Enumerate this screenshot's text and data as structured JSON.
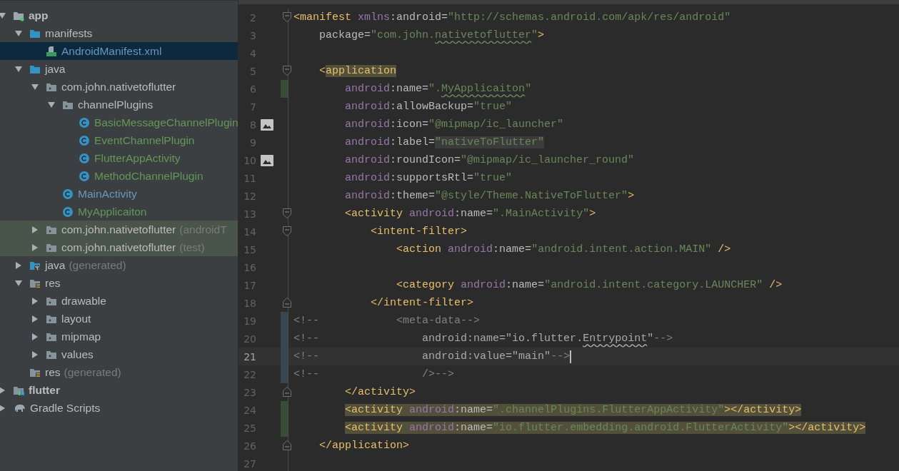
{
  "project_tree": [
    {
      "label": "app",
      "kind": "module",
      "bold": true,
      "expanded": true,
      "selected": false,
      "highlighted": false,
      "color": "#bbbbbb",
      "children": [
        {
          "label": "manifests",
          "kind": "folder",
          "expanded": true,
          "selected": false,
          "highlighted": false,
          "color": "#bbbbbb",
          "children": [
            {
              "label": "AndroidManifest.xml",
              "kind": "manifest",
              "selected": true,
              "highlighted": false,
              "color": "#6897bb"
            }
          ]
        },
        {
          "label": "java",
          "kind": "folder",
          "expanded": true,
          "selected": false,
          "highlighted": false,
          "color": "#bbbbbb",
          "children": [
            {
              "label": "com.john.nativetoflutter",
              "kind": "package",
              "expanded": true,
              "selected": false,
              "highlighted": false,
              "color": "#bbbbbb",
              "children": [
                {
                  "label": "channelPlugins",
                  "kind": "package",
                  "expanded": true,
                  "selected": false,
                  "highlighted": false,
                  "color": "#bbbbbb",
                  "children": [
                    {
                      "label": "BasicMessageChannelPlugin",
                      "kind": "class",
                      "selected": false,
                      "highlighted": false,
                      "color": "#629755"
                    },
                    {
                      "label": "EventChannelPlugin",
                      "kind": "class",
                      "selected": false,
                      "highlighted": false,
                      "color": "#629755"
                    },
                    {
                      "label": "FlutterAppActivity",
                      "kind": "class",
                      "selected": false,
                      "highlighted": false,
                      "color": "#629755"
                    },
                    {
                      "label": "MethodChannelPlugin",
                      "kind": "class",
                      "selected": false,
                      "highlighted": false,
                      "color": "#629755"
                    }
                  ]
                },
                {
                  "label": "MainActivity",
                  "kind": "class",
                  "selected": false,
                  "highlighted": false,
                  "color": "#6897bb"
                },
                {
                  "label": "MyApplicaiton",
                  "kind": "class",
                  "selected": false,
                  "highlighted": false,
                  "color": "#629755"
                }
              ]
            },
            {
              "label": "com.john.nativetoflutter",
              "suffix": "(androidT",
              "kind": "package",
              "expanded": false,
              "selected": false,
              "highlighted": true,
              "color": "#bbbbbb"
            },
            {
              "label": "com.john.nativetoflutter",
              "suffix": "(test)",
              "kind": "package",
              "expanded": false,
              "selected": false,
              "highlighted": true,
              "color": "#bbbbbb"
            }
          ]
        },
        {
          "label": "java",
          "suffix": "(generated)",
          "kind": "generated",
          "expanded": false,
          "selected": false,
          "highlighted": false,
          "color": "#bbbbbb"
        },
        {
          "label": "res",
          "kind": "res",
          "expanded": true,
          "selected": false,
          "highlighted": false,
          "color": "#bbbbbb",
          "children": [
            {
              "label": "drawable",
              "kind": "package",
              "expanded": false,
              "selected": false,
              "highlighted": false,
              "color": "#bbbbbb"
            },
            {
              "label": "layout",
              "kind": "package",
              "expanded": false,
              "selected": false,
              "highlighted": false,
              "color": "#bbbbbb"
            },
            {
              "label": "mipmap",
              "kind": "package",
              "expanded": false,
              "selected": false,
              "highlighted": false,
              "color": "#bbbbbb"
            },
            {
              "label": "values",
              "kind": "package",
              "expanded": false,
              "selected": false,
              "highlighted": false,
              "color": "#bbbbbb"
            }
          ]
        },
        {
          "label": "res",
          "suffix": "(generated)",
          "kind": "res",
          "selected": false,
          "highlighted": false,
          "color": "#bbbbbb"
        }
      ]
    },
    {
      "label": "flutter",
      "kind": "flutter",
      "bold": true,
      "expanded": false,
      "selected": false,
      "highlighted": false,
      "color": "#bbbbbb"
    },
    {
      "label": "Gradle Scripts",
      "kind": "gradle",
      "expanded": false,
      "selected": false,
      "highlighted": false,
      "color": "#bbbbbb"
    }
  ],
  "editor": {
    "lines": [
      {
        "number": "2",
        "kind": "code",
        "fold_start": true,
        "text": "<manifest xmlns:android=\"http://schemas.android.com/apk/res/android\""
      },
      {
        "number": "3",
        "kind": "code",
        "spelling_warning": true,
        "text": "    package=\"com.john.nativetoflutter\">"
      },
      {
        "number": "4",
        "kind": "code"
      },
      {
        "number": "5",
        "kind": "code",
        "fold_start": true,
        "tag_highlight": true,
        "text": "    <application"
      },
      {
        "number": "6",
        "kind": "code",
        "color": "#384c38",
        "spelling_warning": true,
        "text": "        android:name=\".MyApplicaiton\""
      },
      {
        "number": "7",
        "kind": "code",
        "text": "        android:allowBackup=\"true\""
      },
      {
        "number": "8",
        "kind": "image",
        "text": "        android:icon=\"@mipmap/ic_launcher\""
      },
      {
        "number": "9",
        "kind": "code",
        "value_highlight": true,
        "text": "        android:label=\"nativeToFlutter\""
      },
      {
        "number": "10",
        "kind": "image",
        "text": "        android:roundIcon=\"@mipmap/ic_launcher_round\""
      },
      {
        "number": "11",
        "kind": "code",
        "text": "        android:supportsRtl=\"true\""
      },
      {
        "number": "12",
        "kind": "code",
        "text": "        android:theme=\"@style/Theme.NativeToFlutter\">"
      },
      {
        "number": "13",
        "kind": "code",
        "fold_start": true,
        "text": "        <activity android:name=\".MainActivity\">"
      },
      {
        "number": "14",
        "kind": "code",
        "fold_start": true,
        "text": "            <intent-filter>"
      },
      {
        "number": "15",
        "kind": "code",
        "text": "                <action android:name=\"android.intent.action.MAIN\" />"
      },
      {
        "number": "16",
        "kind": "code"
      },
      {
        "number": "17",
        "kind": "code",
        "text": "                <category android:name=\"android.intent.category.LAUNCHER\" />"
      },
      {
        "number": "18",
        "kind": "code",
        "fold_end": true,
        "text": "            </intent-filter>"
      },
      {
        "number": "19",
        "kind": "comment",
        "color": "#374752",
        "prefix": "<!--",
        "text": "            <meta-data-->"
      },
      {
        "number": "20",
        "kind": "comment",
        "color": "#374752",
        "spelling_warning": true,
        "prefix": "<!--",
        "text": "                android:name=\"io.flutter.Entrypoint\"-->"
      },
      {
        "number": "21",
        "kind": "comment",
        "color": "#374752",
        "current": true,
        "cursor": true,
        "prefix": "<!--",
        "text": "                android:value=\"main\"-->"
      },
      {
        "number": "22",
        "kind": "comment",
        "color": "#374752",
        "prefix": "<!--",
        "text": "                />-->"
      },
      {
        "number": "23",
        "kind": "code",
        "fold_end": true,
        "text": "        </activity>"
      },
      {
        "number": "24",
        "kind": "code",
        "color": "#384c38",
        "highlight": true,
        "text": "        <activity android:name=\".channelPlugins.FlutterAppActivity\"></activity>"
      },
      {
        "number": "25",
        "kind": "code",
        "color": "#384c38",
        "highlight": true,
        "text": "        <activity android:name=\"io.flutter.embedding.android.FlutterActivity\"></activity>"
      },
      {
        "number": "26",
        "kind": "code",
        "fold_end": true,
        "text": "    </application>"
      },
      {
        "number": "27",
        "kind": "code"
      }
    ]
  }
}
